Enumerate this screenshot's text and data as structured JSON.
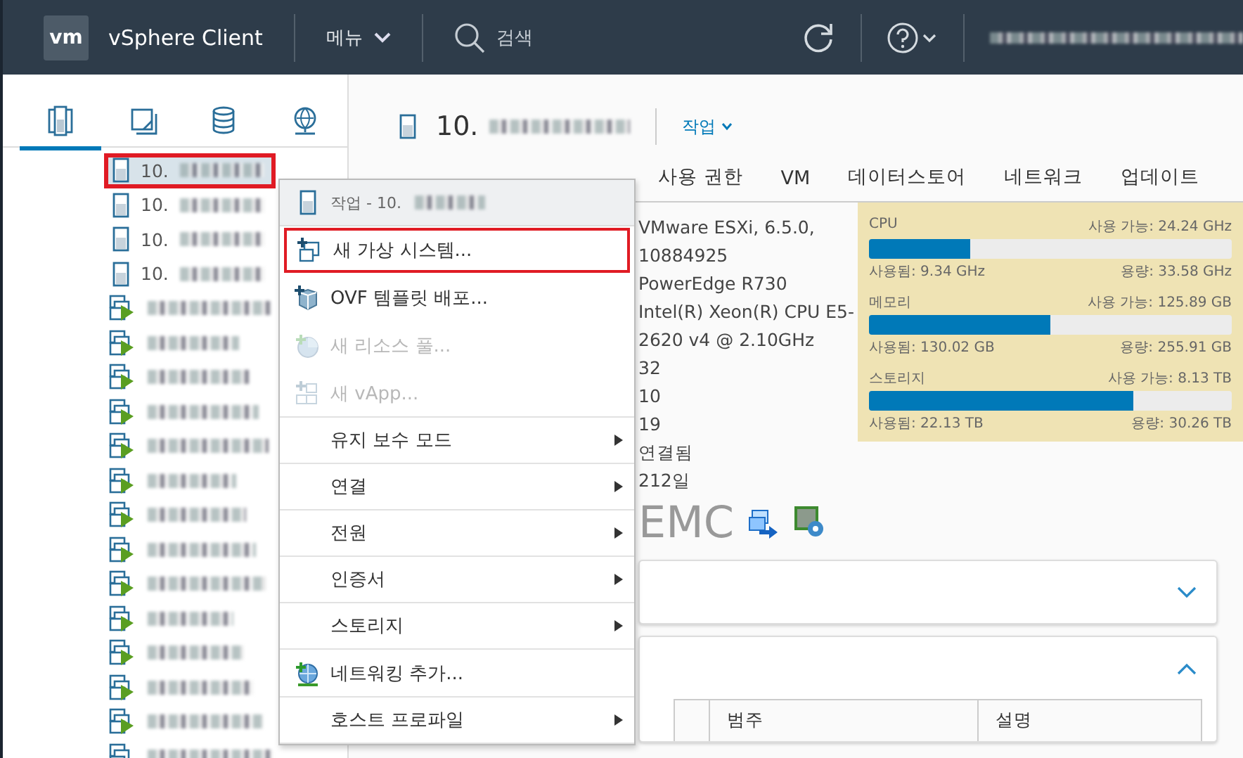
{
  "header": {
    "logo": "vm",
    "title": "vSphere Client",
    "menu": "메뉴",
    "search": "검색"
  },
  "sidebar": {
    "tabs": [
      {
        "kind": "hosts",
        "selected": true
      },
      {
        "kind": "vms",
        "selected": false
      },
      {
        "kind": "storage",
        "selected": false
      },
      {
        "kind": "network",
        "selected": false
      }
    ],
    "tree": [
      {
        "kind": "host",
        "label": "10.",
        "selected": true,
        "highlighted": true
      },
      {
        "kind": "host",
        "label": "10.",
        "selected": false,
        "highlighted": false
      },
      {
        "kind": "host",
        "label": "10.",
        "selected": false,
        "highlighted": false
      },
      {
        "kind": "host",
        "label": "10.",
        "selected": false,
        "highlighted": false
      },
      {
        "kind": "vm",
        "selected": false,
        "highlighted": false
      },
      {
        "kind": "vm",
        "selected": false,
        "highlighted": false
      },
      {
        "kind": "vm",
        "selected": false,
        "highlighted": false
      },
      {
        "kind": "vm",
        "selected": false,
        "highlighted": false
      },
      {
        "kind": "vm",
        "selected": false,
        "highlighted": false
      },
      {
        "kind": "vm",
        "selected": false,
        "highlighted": false
      },
      {
        "kind": "vm",
        "selected": false,
        "highlighted": false
      },
      {
        "kind": "vm",
        "selected": false,
        "highlighted": false
      },
      {
        "kind": "vm",
        "selected": false,
        "highlighted": false
      },
      {
        "kind": "vm",
        "selected": false,
        "highlighted": false
      },
      {
        "kind": "vm",
        "selected": false,
        "highlighted": false
      },
      {
        "kind": "vm",
        "selected": false,
        "highlighted": false
      },
      {
        "kind": "vm",
        "selected": false,
        "highlighted": false
      },
      {
        "kind": "vmoff",
        "selected": false,
        "highlighted": false
      }
    ]
  },
  "main": {
    "host": "10.",
    "actions": "작업",
    "tabs": [
      {
        "label": "사용 권한",
        "selected": false
      },
      {
        "label": "VM",
        "selected": false
      },
      {
        "label": "데이터스토어",
        "selected": false
      },
      {
        "label": "네트워크",
        "selected": false
      },
      {
        "label": "업데이트",
        "selected": false
      }
    ],
    "details": [
      "VMware ESXi, 6.5.0,",
      "10884925",
      "PowerEdge R730",
      "Intel(R) Xeon(R) CPU E5-",
      "2620 v4 @ 2.10GHz",
      "32",
      "10",
      "19",
      "연결됨",
      "212일"
    ],
    "vendor": "EMC",
    "resources": [
      {
        "name": "CPU",
        "free": "사용 가능: 24.24 GHz",
        "level": 0.28,
        "used": "사용됨: 9.34 GHz",
        "capacity": "용량: 33.58 GHz"
      },
      {
        "name": "메모리",
        "free": "사용 가능: 125.89 GB",
        "level": 0.5,
        "used": "사용됨: 130.02 GB",
        "capacity": "용량: 255.91 GB"
      },
      {
        "name": "스토리지",
        "free": "사용 가능: 8.13 TB",
        "level": 0.73,
        "used": "사용됨: 22.13 TB",
        "capacity": "용량: 30.26 TB"
      }
    ],
    "panels": [
      {
        "expanded": false
      },
      {
        "expanded": true
      }
    ],
    "table": {
      "columns": [
        "범주",
        "설명"
      ]
    }
  },
  "context_menu": {
    "title": "작업 - 10.",
    "items": [
      {
        "kind": "newvm",
        "label": "새 가상 시스템...",
        "disabled": false,
        "submenu": false,
        "highlighted": true
      },
      {
        "kind": "ovf",
        "label": "OVF 템플릿 배포...",
        "disabled": false,
        "submenu": false,
        "highlighted": false
      },
      {
        "kind": "pool",
        "label": "새 리소스 풀...",
        "disabled": true,
        "submenu": false,
        "highlighted": false
      },
      {
        "kind": "vapp",
        "label": "새 vApp...",
        "disabled": true,
        "submenu": false,
        "highlighted": false
      },
      {
        "kind": "plain",
        "label": "유지 보수 모드",
        "disabled": false,
        "submenu": true,
        "highlighted": false
      },
      {
        "kind": "plain",
        "label": "연결",
        "disabled": false,
        "submenu": true,
        "highlighted": false
      },
      {
        "kind": "plain",
        "label": "전원",
        "disabled": false,
        "submenu": true,
        "highlighted": false
      },
      {
        "kind": "plain",
        "label": "인증서",
        "disabled": false,
        "submenu": true,
        "highlighted": false
      },
      {
        "kind": "plain",
        "label": "스토리지",
        "disabled": false,
        "submenu": true,
        "highlighted": false
      },
      {
        "kind": "network",
        "label": "네트워킹 추가...",
        "disabled": false,
        "submenu": false,
        "highlighted": false
      },
      {
        "kind": "plain",
        "label": "호스트 프로파일",
        "disabled": false,
        "submenu": true,
        "highlighted": false
      }
    ]
  }
}
